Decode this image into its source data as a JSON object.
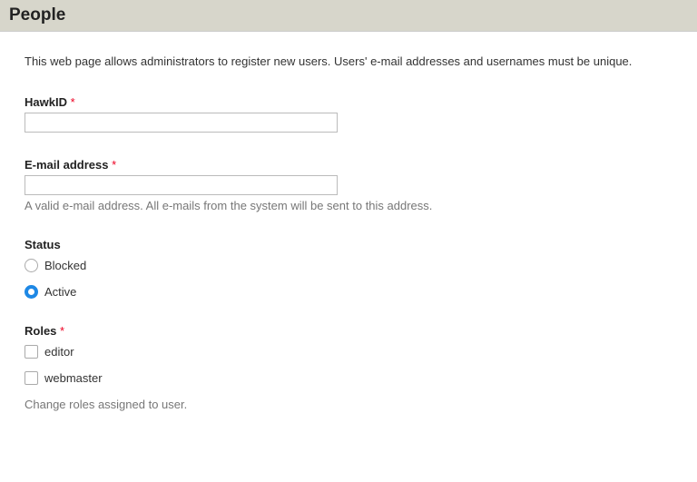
{
  "header": {
    "title": "People"
  },
  "intro": "This web page allows administrators to register new users. Users' e-mail addresses and usernames must be unique.",
  "fields": {
    "hawkid": {
      "label": "HawkID",
      "required_mark": "*",
      "value": ""
    },
    "email": {
      "label": "E-mail address",
      "required_mark": "*",
      "value": "",
      "description": "A valid e-mail address. All e-mails from the system will be sent to this address."
    },
    "status": {
      "label": "Status",
      "options": {
        "blocked": "Blocked",
        "active": "Active"
      },
      "selected": "active"
    },
    "roles": {
      "label": "Roles",
      "required_mark": "*",
      "options": {
        "editor": "editor",
        "webmaster": "webmaster"
      },
      "description": "Change roles assigned to user."
    }
  }
}
